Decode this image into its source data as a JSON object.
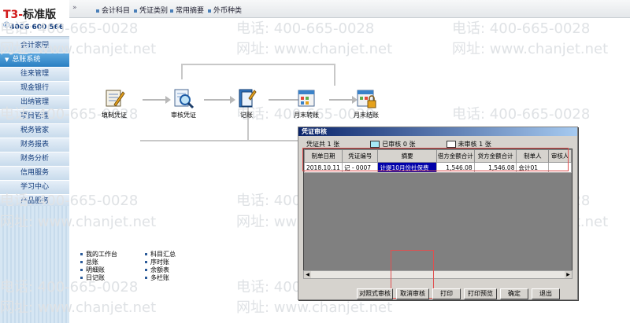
{
  "brand": {
    "title_prefix": "T3-",
    "title_suffix": "标准版",
    "phone": "4006 600 566"
  },
  "sidebar": {
    "items": [
      {
        "label": "会计家园"
      },
      {
        "label": "总账系统"
      },
      {
        "label": "往来管理"
      },
      {
        "label": "现金银行"
      },
      {
        "label": "出纳管理"
      },
      {
        "label": "项目管理"
      },
      {
        "label": "税务管家"
      },
      {
        "label": "财务报表"
      },
      {
        "label": "财务分析"
      },
      {
        "label": "信用服务"
      },
      {
        "label": "学习中心"
      },
      {
        "label": "产品服务"
      }
    ],
    "active_index": 1
  },
  "toolbar": {
    "grip": "»",
    "items": [
      "会计科目",
      "凭证类别",
      "常用摘要",
      "外币种类"
    ]
  },
  "watermark": {
    "phone": "电话: 400-665-0028",
    "site": "网址: www.chanjet.net"
  },
  "flow": {
    "nodes": [
      "填制凭证",
      "审核凭证",
      "记账",
      "月末转账",
      "月末结账"
    ]
  },
  "links": {
    "col1": [
      "我的工作台",
      "总账",
      "明细账",
      "日记账"
    ],
    "col2": [
      "科目汇总",
      "序时账",
      "余额表",
      "多栏账"
    ]
  },
  "dialog": {
    "title": "凭证审核",
    "stats": {
      "total": "凭证共 1 张",
      "reviewed": "已审核 0 张",
      "unreviewed": "未审核 1 张"
    },
    "colors": {
      "reviewed_swatch": "#a6e8f5",
      "unreviewed_swatch": "#ffffff",
      "selected": "#0000aa"
    },
    "columns": [
      "制单日期",
      "凭证编号",
      "摘要",
      "借方金额合计",
      "贷方金额合计",
      "制单人",
      "审核人"
    ],
    "rows": [
      [
        "2018.10.11",
        "记 - 0007",
        "计提10月份社保费",
        "1,546.08",
        "1,546.08",
        "会计01",
        ""
      ]
    ],
    "buttons": [
      "对照式审核",
      "取消审核",
      "打印",
      "打印预览",
      "确定",
      "退出"
    ]
  }
}
